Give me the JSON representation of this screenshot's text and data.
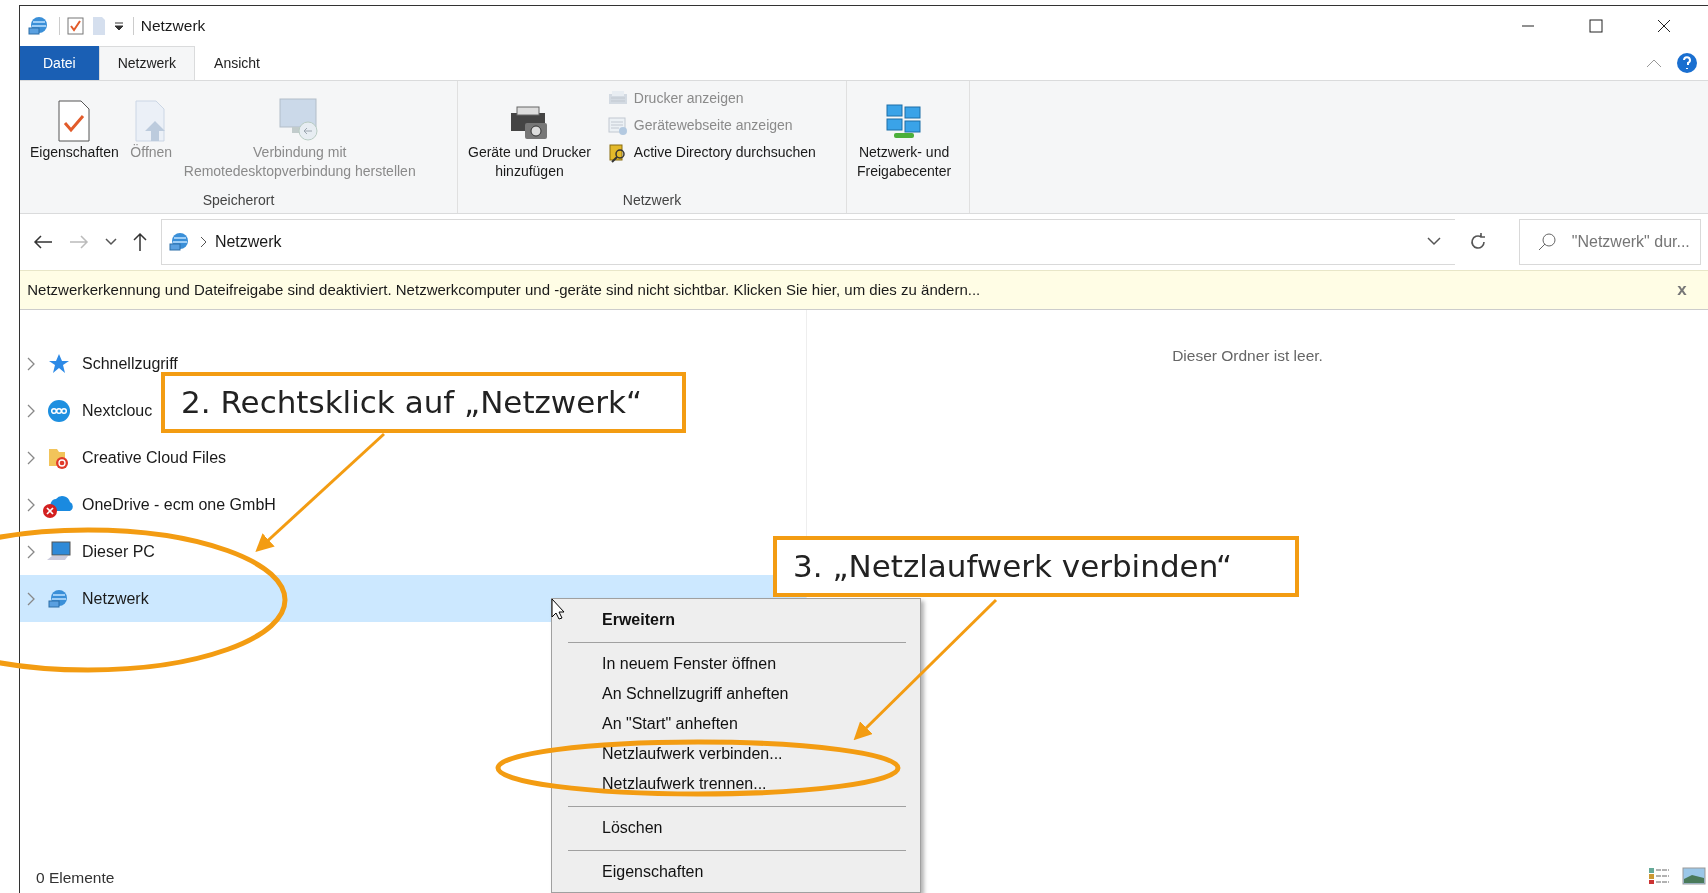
{
  "window": {
    "title": "Netzwerk"
  },
  "ribbon_tabs": [
    {
      "label": "Datei",
      "kind": "file",
      "selected": false
    },
    {
      "label": "Netzwerk",
      "kind": "tab",
      "selected": true
    },
    {
      "label": "Ansicht",
      "kind": "tab",
      "selected": false
    }
  ],
  "ribbon_groups": [
    {
      "label": "Speicherort",
      "commands": [
        {
          "label": "Eigenschaften",
          "kind": "properties",
          "disabled": false
        },
        {
          "label": "Öffnen",
          "kind": "open",
          "disabled": true
        },
        {
          "label": "Verbindung mit\nRemotedesktopverbindung herstellen",
          "kind": "remote",
          "disabled": true
        }
      ]
    },
    {
      "label": "Netzwerk",
      "commands": [
        {
          "label": "Geräte und Drucker\nhinzufügen",
          "kind": "devices",
          "disabled": false
        },
        {
          "label": "Drucker anzeigen",
          "kind": "printers",
          "disabled": true
        },
        {
          "label": "Gerätewebseite anzeigen",
          "kind": "webpage",
          "disabled": true
        },
        {
          "label": "Active Directory durchsuchen",
          "kind": "directory",
          "disabled": false
        }
      ]
    },
    {
      "commands": [
        {
          "label": "Netzwerk- und\nFreigabecenter",
          "kind": "sharing",
          "disabled": false
        }
      ]
    }
  ],
  "address_bar": {
    "path": [
      "Netzwerk"
    ]
  },
  "search": {
    "placeholder": "\"Netzwerk\" dur..."
  },
  "info_bar": {
    "text": "Netzwerkerkennung und Dateifreigabe sind deaktiviert. Netzwerkcomputer und -geräte sind nicht sichtbar. Klicken Sie hier, um dies zu ändern...",
    "close": "x"
  },
  "navigation_tree": [
    {
      "label": "Schnellzugriff",
      "kind": "quick",
      "selected": false
    },
    {
      "label": "Nextclouc",
      "kind": "nextcloud",
      "selected": false
    },
    {
      "label": "Creative Cloud Files",
      "kind": "cc",
      "selected": false
    },
    {
      "label": "OneDrive - ecm one GmbH",
      "kind": "onedrive",
      "selected": false
    },
    {
      "label": "Dieser PC",
      "kind": "pc",
      "selected": false
    },
    {
      "label": "Netzwerk",
      "kind": "network",
      "selected": true
    }
  ],
  "content": {
    "empty_message": "Dieser Ordner ist leer."
  },
  "status_bar": {
    "item_count": "0 Elemente"
  },
  "context_menu": [
    {
      "kind": "item",
      "label": "Erweitern",
      "default": true
    },
    {
      "kind": "separator"
    },
    {
      "kind": "item",
      "label": "In neuem Fenster öffnen",
      "default": false
    },
    {
      "kind": "item",
      "label": "An Schnellzugriff anheften",
      "default": false
    },
    {
      "kind": "item",
      "label": "An \"Start\" anheften",
      "default": false
    },
    {
      "kind": "item",
      "label": "Netzlaufwerk verbinden...",
      "default": false
    },
    {
      "kind": "item",
      "label": "Netzlaufwerk trennen...",
      "default": false
    },
    {
      "kind": "separator"
    },
    {
      "kind": "item",
      "label": "Löschen",
      "default": false
    },
    {
      "kind": "separator"
    },
    {
      "kind": "item",
      "label": "Eigenschaften",
      "default": false
    }
  ],
  "annotations": [
    {
      "text": "2. Rechtsklick auf „Netzwerk“"
    },
    {
      "text": "3. „Netzlaufwerk verbinden“"
    }
  ]
}
